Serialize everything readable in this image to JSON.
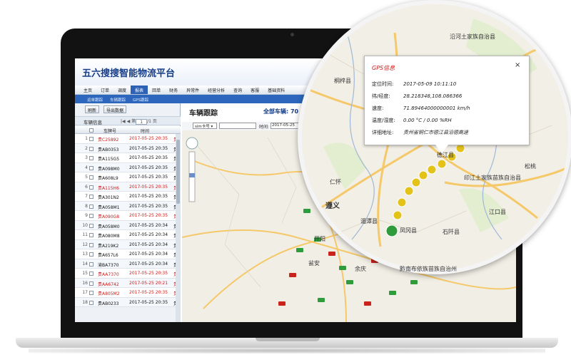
{
  "app": {
    "title": "五六搜搜智能物流平台",
    "nav": [
      "主页",
      "订单",
      "调度",
      "报表",
      "回单",
      "财务",
      "异常件",
      "经营分析",
      "查询",
      "客服",
      "基础资料"
    ],
    "active_nav_index": 3,
    "subnav": [
      "运单跟踪",
      "车辆跟踪",
      "GPS跟踪"
    ]
  },
  "toolbar": {
    "refresh": "刷新",
    "export": "导出数据"
  },
  "vehicle_panel": {
    "title": "车辆信息",
    "page_current": "1",
    "page_total": "/1 页",
    "columns": [
      "车牌号",
      "时间"
    ],
    "rows": [
      {
        "num": "1",
        "plate": "贵C25892",
        "time": "2017-05-25 20:35",
        "owner": "贵",
        "alarm": true
      },
      {
        "num": "2",
        "plate": "贵AB0353",
        "time": "2017-05-25 20:35",
        "owner": "贵",
        "alarm": false
      },
      {
        "num": "3",
        "plate": "贵A115G5",
        "time": "2017-05-25 20:35",
        "owner": "贵",
        "alarm": false
      },
      {
        "num": "4",
        "plate": "贵A098M0",
        "time": "2017-05-25 20:35",
        "owner": "贵",
        "alarm": false
      },
      {
        "num": "5",
        "plate": "贵A608L9",
        "time": "2017-05-25 20:35",
        "owner": "贵",
        "alarm": false
      },
      {
        "num": "6",
        "plate": "贵A115H6",
        "time": "2017-05-25 20:35",
        "owner": "贵",
        "alarm": true
      },
      {
        "num": "7",
        "plate": "贵A301N2",
        "time": "2017-05-25 20:35",
        "owner": "贵",
        "alarm": false
      },
      {
        "num": "8",
        "plate": "贵A058M1",
        "time": "2017-05-25 20:35",
        "owner": "贵",
        "alarm": false
      },
      {
        "num": "9",
        "plate": "贵A090G8",
        "time": "2017-05-25 20:35",
        "owner": "贵",
        "alarm": true
      },
      {
        "num": "10",
        "plate": "贵A058M0",
        "time": "2017-05-25 20:34",
        "owner": "贵",
        "alarm": false
      },
      {
        "num": "11",
        "plate": "贵A080M8",
        "time": "2017-05-25 20:34",
        "owner": "贵",
        "alarm": false
      },
      {
        "num": "12",
        "plate": "贵A219K2",
        "time": "2017-05-25 20:34",
        "owner": "贵",
        "alarm": false
      },
      {
        "num": "13",
        "plate": "贵A657L6",
        "time": "2017-05-25 20:34",
        "owner": "贵",
        "alarm": false
      },
      {
        "num": "14",
        "plate": "渝BA7370",
        "time": "2017-05-25 20:34",
        "owner": "贵",
        "alarm": false
      },
      {
        "num": "15",
        "plate": "贵AA7370",
        "time": "2017-05-25 20:35",
        "owner": "贵",
        "alarm": true
      },
      {
        "num": "16",
        "plate": "贵AA6742",
        "time": "2017-05-25 20:21",
        "owner": "贵",
        "alarm": true
      },
      {
        "num": "17",
        "plate": "贵A805M2",
        "time": "2017-05-25 20:35",
        "owner": "贵",
        "alarm": true
      },
      {
        "num": "18",
        "plate": "贵AB0233",
        "time": "2017-05-25 20:35",
        "owner": "贵",
        "alarm": false
      }
    ]
  },
  "tracking": {
    "title": "车辆跟踪",
    "total_label": "全部车辆: 70",
    "sim_select": "sim卡号",
    "time_label": "时间:",
    "time_value": "2017-05-25"
  },
  "map_labels": {
    "zunyi": "遵义",
    "weng_an": "瓮安",
    "renhuai": "仁怀",
    "yuqing": "余庆",
    "kaiyang": "开阳",
    "qiannan": "黔南布依族苗族自治州",
    "fenggang": "凤冈县",
    "meitan": "湄潭县",
    "yinjiang": "印江土家族苗族自治县",
    "yanhe": "沿河土家族自治县",
    "jiangkou": "江口县",
    "shiqian": "石阡县",
    "dejiang": "德江县",
    "tongzi": "桐梓县",
    "songtao": "松桃"
  },
  "gps_popup": {
    "title": "GPS信息",
    "close": "×",
    "fields": [
      {
        "label": "定位时间:",
        "value": "2017-05-09 10:11:10"
      },
      {
        "label": "纬/经度:",
        "value": "28.218348,108.086366"
      },
      {
        "label": "速度:",
        "value": "71.89464000000001 km/h"
      },
      {
        "label": "温度/湿度:",
        "value": "0.00 °C / 0.00 %RH"
      },
      {
        "label": "详细地址:",
        "value": "贵州省铜仁市德江县沿德高速"
      }
    ]
  },
  "colors": {
    "nav_active": "#2d61b5",
    "subnav": "#2c67bd",
    "alarm_text": "#d01717",
    "title_blue": "#173d85",
    "truck_green": "#2e9c3a",
    "truck_red": "#c9231c",
    "truck_yellow": "#e3c21a"
  }
}
